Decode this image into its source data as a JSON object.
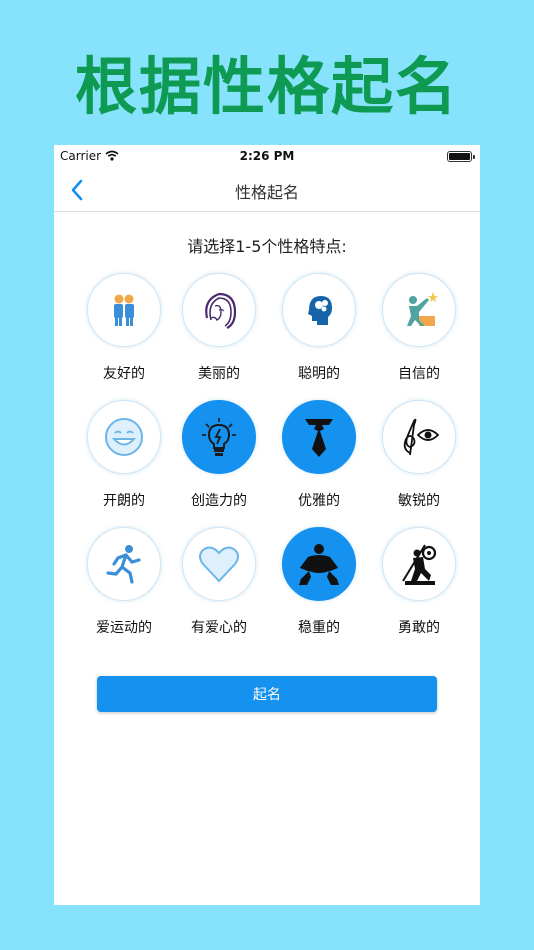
{
  "promo": {
    "title": "根据性格起名"
  },
  "status": {
    "carrier": "Carrier",
    "time": "2:26 PM"
  },
  "nav": {
    "title": "性格起名"
  },
  "prompt": "请选择1-5个性格特点:",
  "traits": [
    {
      "label": "友好的",
      "icon": "friends-icon",
      "selected": false
    },
    {
      "label": "美丽的",
      "icon": "woman-face-icon",
      "selected": false
    },
    {
      "label": "聪明的",
      "icon": "brain-head-icon",
      "selected": false
    },
    {
      "label": "自信的",
      "icon": "confident-person-icon",
      "selected": false
    },
    {
      "label": "开朗的",
      "icon": "smiley-face-icon",
      "selected": false
    },
    {
      "label": "创造力的",
      "icon": "light-bulb-icon",
      "selected": true
    },
    {
      "label": "优雅的",
      "icon": "necktie-icon",
      "selected": true
    },
    {
      "label": "敏锐的",
      "icon": "eye-clef-icon",
      "selected": false
    },
    {
      "label": "爱运动的",
      "icon": "runner-icon",
      "selected": false
    },
    {
      "label": "有爱心的",
      "icon": "heart-icon",
      "selected": false
    },
    {
      "label": "稳重的",
      "icon": "sumo-icon",
      "selected": true
    },
    {
      "label": "勇敢的",
      "icon": "warrior-icon",
      "selected": false
    }
  ],
  "submit_label": "起名",
  "colors": {
    "accent": "#1591F0",
    "promo_green": "#0E9A52",
    "background": "#86E3FB"
  }
}
